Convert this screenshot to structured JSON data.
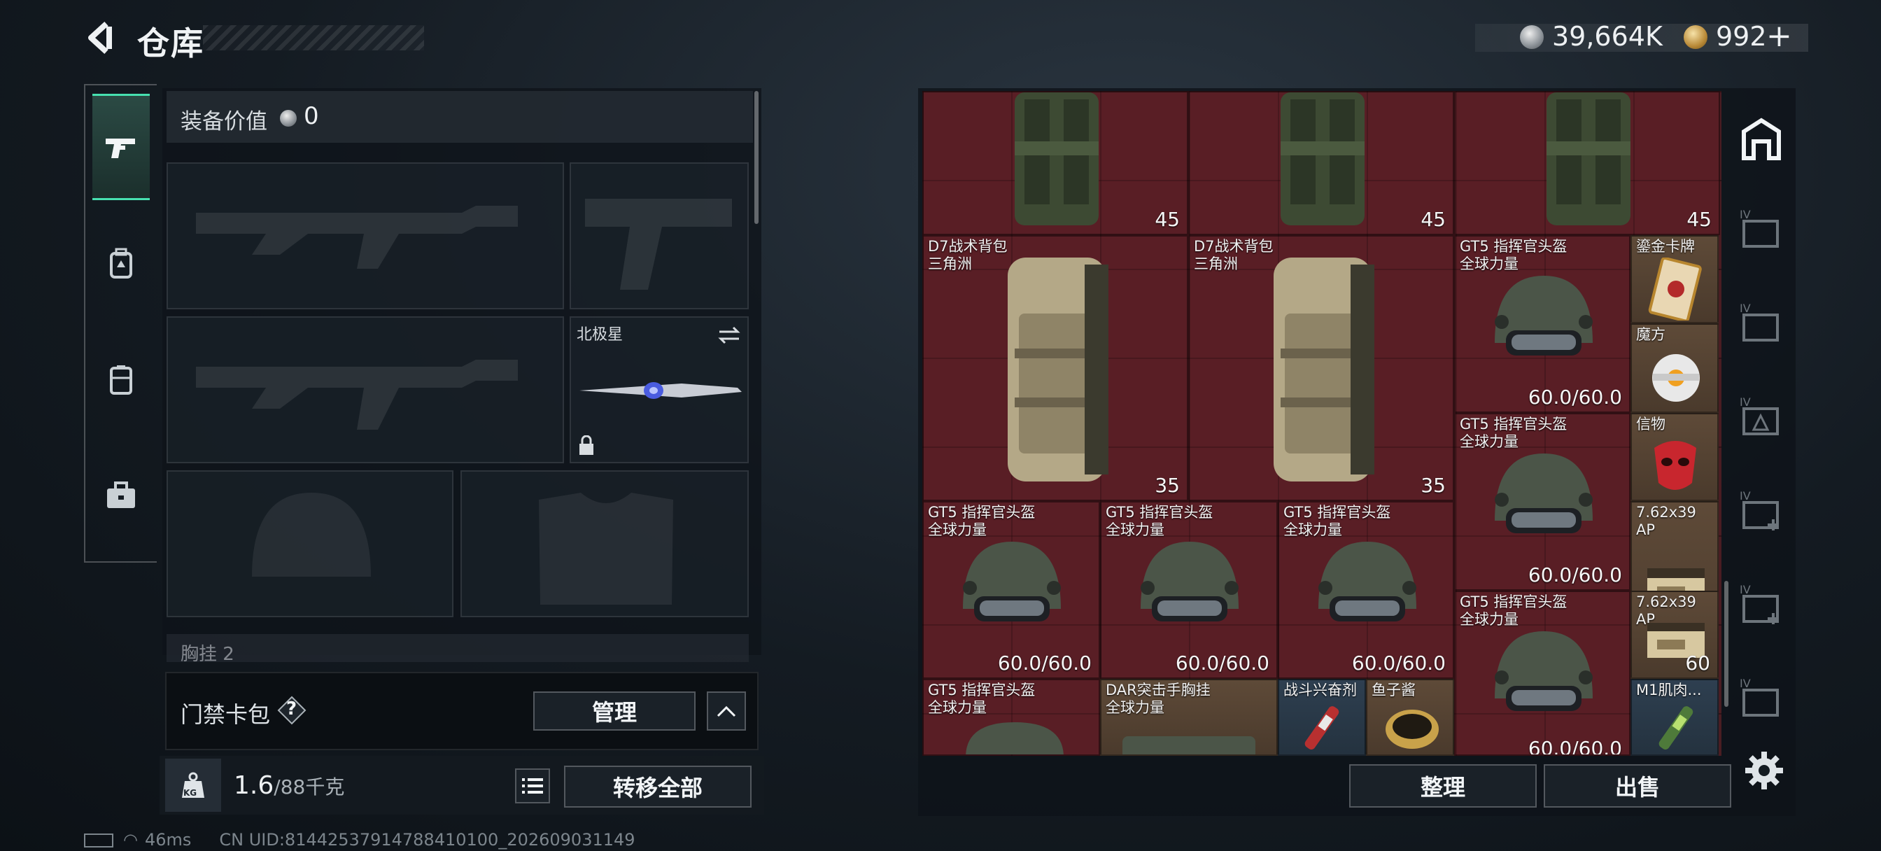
{
  "header": {
    "title": "仓库",
    "silver_amount": "39,664K",
    "gold_amount": "992",
    "plus_label": "+"
  },
  "equipment": {
    "value_label": "装备价值",
    "value": "0",
    "melee_slot_name": "北极星",
    "chest_rig_label": "胸挂",
    "chest_rig_count": "2"
  },
  "keycard": {
    "label": "门禁卡包",
    "help": "?",
    "manage_label": "管理"
  },
  "bottom_bar": {
    "weight_value": "1.6",
    "weight_max": "/88千克",
    "kg_badge": "KG",
    "transfer_all_label": "转移全部"
  },
  "status": {
    "ping": "46ms",
    "uid": "CN UID:81442537914788410100_202609031149"
  },
  "stash": {
    "items": [
      {
        "name": "",
        "count": "45"
      },
      {
        "name": "",
        "count": "45"
      },
      {
        "name": "",
        "count": "45"
      },
      {
        "name": "D7战术背包\n三角洲",
        "count": "35"
      },
      {
        "name": "D7战术背包\n三角洲",
        "count": "35"
      },
      {
        "name": "GT5 指挥官头盔\n全球力量",
        "count": "60.0/60.0"
      },
      {
        "name": "鎏金卡牌",
        "count": ""
      },
      {
        "name": "魔方",
        "count": ""
      },
      {
        "name": "GT5 指挥官头盔\n全球力量",
        "count": "60.0/60.0"
      },
      {
        "name": "信物",
        "count": ""
      },
      {
        "name": "GT5 指挥官头盔\n全球力量",
        "count": "60.0/60.0"
      },
      {
        "name": "GT5 指挥官头盔\n全球力量",
        "count": "60.0/60.0"
      },
      {
        "name": "GT5 指挥官头盔\n全球力量",
        "count": "60.0/60.0"
      },
      {
        "name": "7.62x39\nAP",
        "count": "60"
      },
      {
        "name": "GT5 指挥官头盔\n全球力量",
        "count": "60.0/60.0"
      },
      {
        "name": "7.62x39\nAP",
        "count": "60"
      },
      {
        "name": "GT5 指挥官头盔\n全球力量",
        "count": ""
      },
      {
        "name": "DAR突击手胸挂\n全球力量",
        "count": ""
      },
      {
        "name": "战斗兴奋剂",
        "count": ""
      },
      {
        "name": "鱼子酱",
        "count": ""
      },
      {
        "name": "M1肌肉...",
        "count": ""
      }
    ],
    "sort_label": "整理",
    "sell_label": "出售",
    "side_tab_prefix": "IV"
  },
  "colors": {
    "accent": "#47e0b0",
    "stash_bg": "#4a1d23",
    "panel_bg": "#0e1319"
  }
}
